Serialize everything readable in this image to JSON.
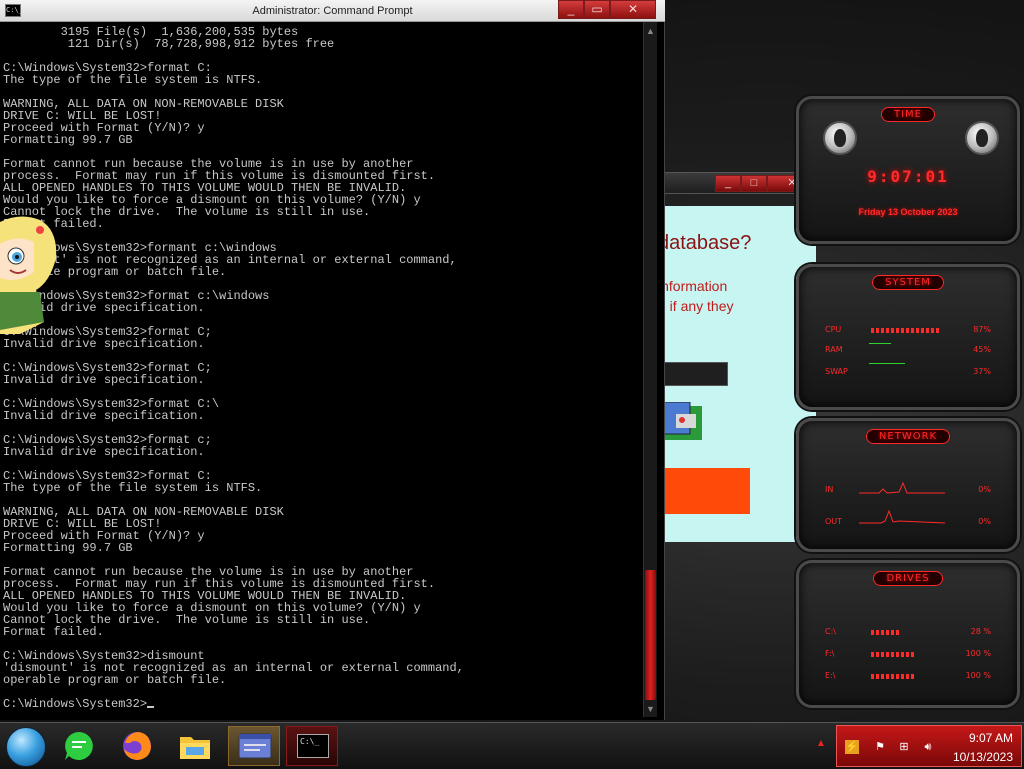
{
  "cmd_window": {
    "title": "Administrator: Command Prompt",
    "sysicon": "C:\\_",
    "minimize_glyph": "_",
    "restore_glyph": "▭",
    "close_glyph": "✕",
    "lines": [
      "        3195 File(s)  1,636,200,535 bytes",
      "         121 Dir(s)  78,728,998,912 bytes free",
      "",
      "C:\\Windows\\System32>format C:",
      "The type of the file system is NTFS.",
      "",
      "WARNING, ALL DATA ON NON-REMOVABLE DISK",
      "DRIVE C: WILL BE LOST!",
      "Proceed with Format (Y/N)? y",
      "Formatting 99.7 GB",
      "",
      "Format cannot run because the volume is in use by another",
      "process.  Format may run if this volume is dismounted first.",
      "ALL OPENED HANDLES TO THIS VOLUME WOULD THEN BE INVALID.",
      "Would you like to force a dismount on this volume? (Y/N) y",
      "Cannot lock the drive.  The volume is still in use.",
      "Format failed.",
      "",
      "C:\\Windows\\System32>formant c:\\windows",
      "'formant' is not recognized as an internal or external command,",
      "operable program or batch file.",
      "",
      "C:\\Windows\\System32>format c:\\windows",
      "Invalid drive specification.",
      "",
      "C:\\Windows\\System32>format C;",
      "Invalid drive specification.",
      "",
      "C:\\Windows\\System32>format C;",
      "Invalid drive specification.",
      "",
      "C:\\Windows\\System32>format C:\\",
      "Invalid drive specification.",
      "",
      "C:\\Windows\\System32>format c;",
      "Invalid drive specification.",
      "",
      "C:\\Windows\\System32>format C:",
      "The type of the file system is NTFS.",
      "",
      "WARNING, ALL DATA ON NON-REMOVABLE DISK",
      "DRIVE C: WILL BE LOST!",
      "Proceed with Format (Y/N)? y",
      "Formatting 99.7 GB",
      "",
      "Format cannot run because the volume is in use by another",
      "process.  Format may run if this volume is dismounted first.",
      "ALL OPENED HANDLES TO THIS VOLUME WOULD THEN BE INVALID.",
      "Would you like to force a dismount on this volume? (Y/N) y",
      "Cannot lock the drive.  The volume is still in use.",
      "Format failed.",
      "",
      "C:\\Windows\\System32>dismount",
      "'dismount' is not recognized as an internal or external command,",
      "operable program or batch file.",
      ""
    ],
    "prompt": "C:\\Windows\\System32>"
  },
  "bg_dialog": {
    "heading": "database?",
    "line1": "information",
    "line2": "e if any they",
    "minimize_glyph": "_",
    "restore_glyph": "□",
    "close_glyph": "✕"
  },
  "gadgets": {
    "time": {
      "title": "TIME",
      "clock": "9:07:01",
      "date": "Friday 13 October 2023"
    },
    "system": {
      "title": "SYSTEM",
      "rows": [
        {
          "label": "CPU",
          "value": "87%",
          "level": 0.87
        },
        {
          "label": "RAM",
          "value": "45%",
          "level": 0.45
        },
        {
          "label": "SWAP",
          "value": "37%",
          "level": 0.37
        }
      ]
    },
    "network": {
      "title": "NETWORK",
      "rows": [
        {
          "label": "IN",
          "value": "0%"
        },
        {
          "label": "OUT",
          "value": "0%"
        }
      ]
    },
    "drives": {
      "title": "DRIVES",
      "rows": [
        {
          "label": "C:\\",
          "value": "28 %",
          "level": 0.28
        },
        {
          "label": "F:\\",
          "value": "100 %",
          "level": 1.0
        },
        {
          "label": "E:\\",
          "value": "100 %",
          "level": 1.0
        }
      ]
    }
  },
  "taskbar": {
    "clock_time": "9:07 AM",
    "clock_date": "10/13/2023",
    "cmd_task_label": "C:\\_",
    "icons": [
      "start-orb-icon",
      "chat-icon",
      "firefox-icon",
      "file-explorer-icon",
      "window-app-icon",
      "command-prompt-icon"
    ],
    "tray_icons": [
      "show-hidden-icons-icon",
      "app-tray-icon",
      "flag-icon",
      "network-icon",
      "volume-icon"
    ]
  },
  "colors": {
    "accent_red": "#ff2a2a",
    "tray_red": "#c51818",
    "console_text": "#c8c8c8",
    "dialog_bg": "#c7f5f1"
  }
}
